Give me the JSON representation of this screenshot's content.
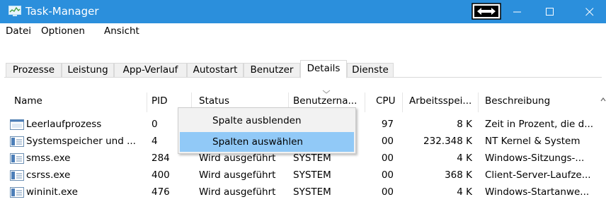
{
  "window": {
    "title": "Task-Manager",
    "app_icon": "task-manager-icon",
    "controls": [
      "minimize-icon",
      "maximize-icon",
      "close-icon"
    ],
    "colors": {
      "titlebar": "#2b8fdc",
      "highlight": "#91c9f7"
    }
  },
  "menu": [
    "Datei",
    "Optionen",
    "Ansicht"
  ],
  "tabs": {
    "items": [
      "Prozesse",
      "Leistung",
      "App-Verlauf",
      "Autostart",
      "Benutzer",
      "Details",
      "Dienste"
    ],
    "active": "Details"
  },
  "table": {
    "columns": [
      "Name",
      "PID",
      "Status",
      "Benutzerna...",
      "CPU",
      "Arbeitsspei...",
      "Beschreibung"
    ],
    "sorted_column": "Benutzerna...",
    "rows": [
      [
        "Leerlaufprozess",
        "0",
        "",
        "",
        "97",
        "8 K",
        "Zeit in Prozent, die d..."
      ],
      [
        "Systemspeicher und ...",
        "4",
        "",
        "",
        "00",
        "232.348 K",
        "NT Kernel & System"
      ],
      [
        "smss.exe",
        "284",
        "Wird ausgeführt",
        "SYSTEM",
        "00",
        "4 K",
        "Windows-Sitzungs-..."
      ],
      [
        "csrss.exe",
        "400",
        "Wird ausgeführt",
        "SYSTEM",
        "00",
        "368 K",
        "Client-Server-Laufze..."
      ],
      [
        "wininit.exe",
        "476",
        "Wird ausgeführt",
        "SYSTEM",
        "00",
        "4 K",
        "Windows-Startanwe..."
      ]
    ]
  },
  "context_menu": {
    "items": [
      "Spalte ausblenden",
      "Spalten auswählen"
    ],
    "highlighted": "Spalten auswählen"
  }
}
